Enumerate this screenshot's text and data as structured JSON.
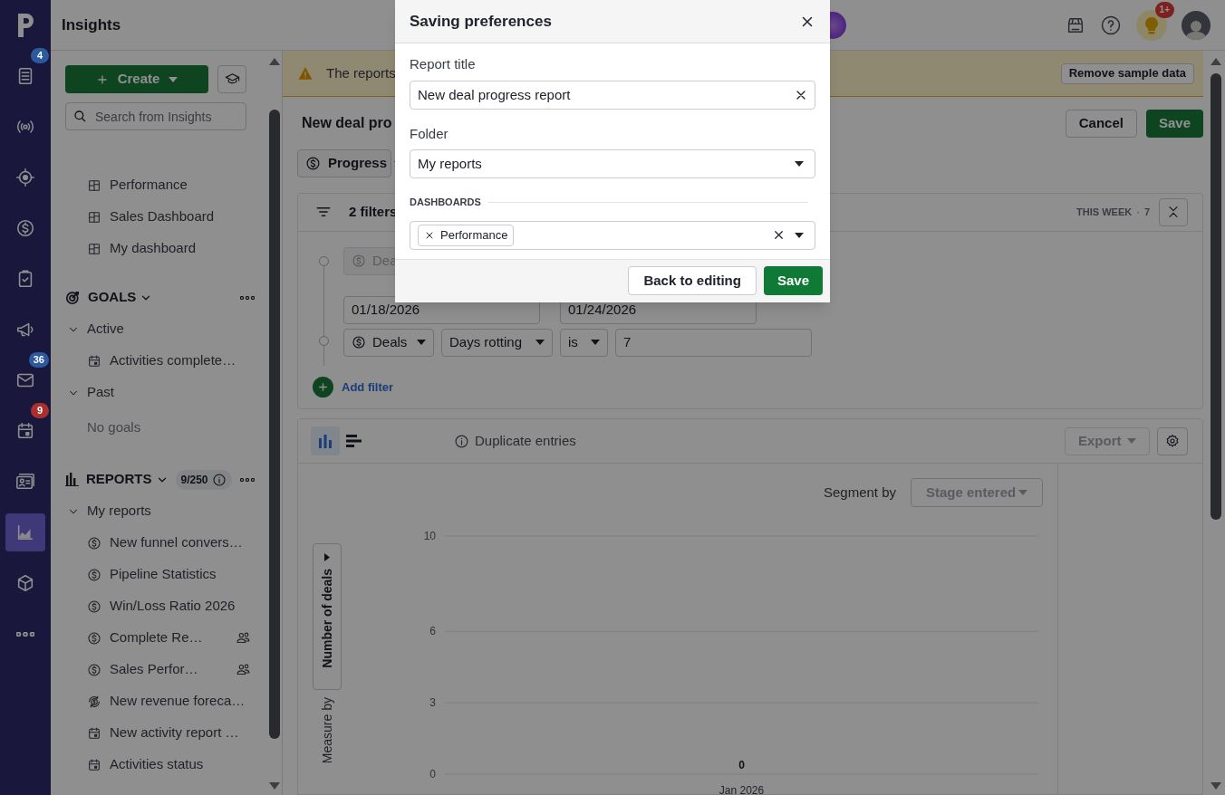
{
  "nav_rail": {
    "items": [
      {
        "kind": "list",
        "selected": false,
        "badge": {
          "text": "4",
          "color": "#2b5a9e"
        }
      },
      {
        "kind": "signal",
        "selected": false
      },
      {
        "kind": "target",
        "selected": false
      },
      {
        "kind": "dollar",
        "selected": false
      },
      {
        "kind": "clipboard",
        "selected": false
      },
      {
        "kind": "megaphone",
        "selected": false
      },
      {
        "kind": "mail",
        "selected": false,
        "badge": {
          "text": "36",
          "color": "#2b5a9e"
        }
      },
      {
        "kind": "calendar",
        "selected": false,
        "badge": {
          "text": "9",
          "color": "#a8302f"
        }
      },
      {
        "kind": "contact",
        "selected": false
      },
      {
        "kind": "chart",
        "selected": true
      },
      {
        "kind": "box",
        "selected": false
      },
      {
        "kind": "more",
        "selected": false
      }
    ]
  },
  "top_bar": {
    "title": "Insights",
    "notification_badge": "1+"
  },
  "sidebar": {
    "create_button": "Create",
    "search": {
      "placeholder": "Search from Insights"
    },
    "dashboards": {
      "items": [
        "Performance",
        "Sales Dashboard",
        "My dashboard"
      ]
    },
    "goals": {
      "heading": "GOALS",
      "groups": [
        {
          "label": "Active",
          "expanded": true,
          "children": [
            {
              "label": "Activities complete…",
              "kind": "activity",
              "shared": false
            }
          ]
        },
        {
          "label": "Past",
          "expanded": true,
          "empty_text": "No goals"
        }
      ]
    },
    "reports": {
      "heading": "REPORTS",
      "count": "9/250",
      "groups": [
        {
          "label": "My reports",
          "expanded": true,
          "children": [
            {
              "label": "New funnel convers…",
              "kind": "deal",
              "shared": false
            },
            {
              "label": "Pipeline Statistics",
              "kind": "deal",
              "shared": false
            },
            {
              "label": "Win/Loss Ratio 2026",
              "kind": "deal",
              "shared": false
            },
            {
              "label": "Complete Re…",
              "kind": "deal",
              "shared": true
            },
            {
              "label": "Sales Perfor…",
              "kind": "deal",
              "shared": true
            },
            {
              "label": "New revenue foreca…",
              "kind": "revenue",
              "shared": false
            },
            {
              "label": "New activity report …",
              "kind": "activity",
              "shared": false
            },
            {
              "label": "Activities status",
              "kind": "activity",
              "shared": false
            }
          ]
        }
      ]
    }
  },
  "banner": {
    "text": "The reports",
    "button": "Remove sample data"
  },
  "report": {
    "title": "New deal pro",
    "cancel": "Cancel",
    "save": "Save",
    "entity": "Progress"
  },
  "filters": {
    "summary": "2 filters",
    "period": "THIS WEEK",
    "period_separator": "·",
    "period_count": "7",
    "first_filter": {
      "entity": "Dea",
      "start": "01/18/2026",
      "end": "01/24/2026"
    },
    "second_filter": {
      "entity": "Deals",
      "field": "Days rotting",
      "operator": "is",
      "value": "7"
    },
    "add": "Add filter"
  },
  "chart_panel": {
    "view_toggles": [
      {
        "kind": "column",
        "selected": true
      },
      {
        "kind": "bar",
        "selected": false
      }
    ],
    "duplicate_entries": "Duplicate entries",
    "export": "Export",
    "segment_label": "Segment by",
    "segment_value": "Stage entered",
    "measure_label": "Measure by",
    "measure_value": "Number of deals",
    "chart_data": {
      "type": "bar",
      "categories": [
        "Jan 2026"
      ],
      "values": [
        0
      ],
      "ylim": [
        0,
        10
      ],
      "yticks": [
        0,
        3,
        6,
        10
      ],
      "data_labels": true
    }
  },
  "modal": {
    "title": "Saving preferences",
    "report_title": {
      "label": "Report title",
      "value": "New deal progress report"
    },
    "folder": {
      "label": "Folder",
      "value": "My reports"
    },
    "dashboards": {
      "label": "DASHBOARDS",
      "tags": [
        "Performance"
      ]
    },
    "back_button": "Back to editing",
    "save_button": "Save"
  }
}
